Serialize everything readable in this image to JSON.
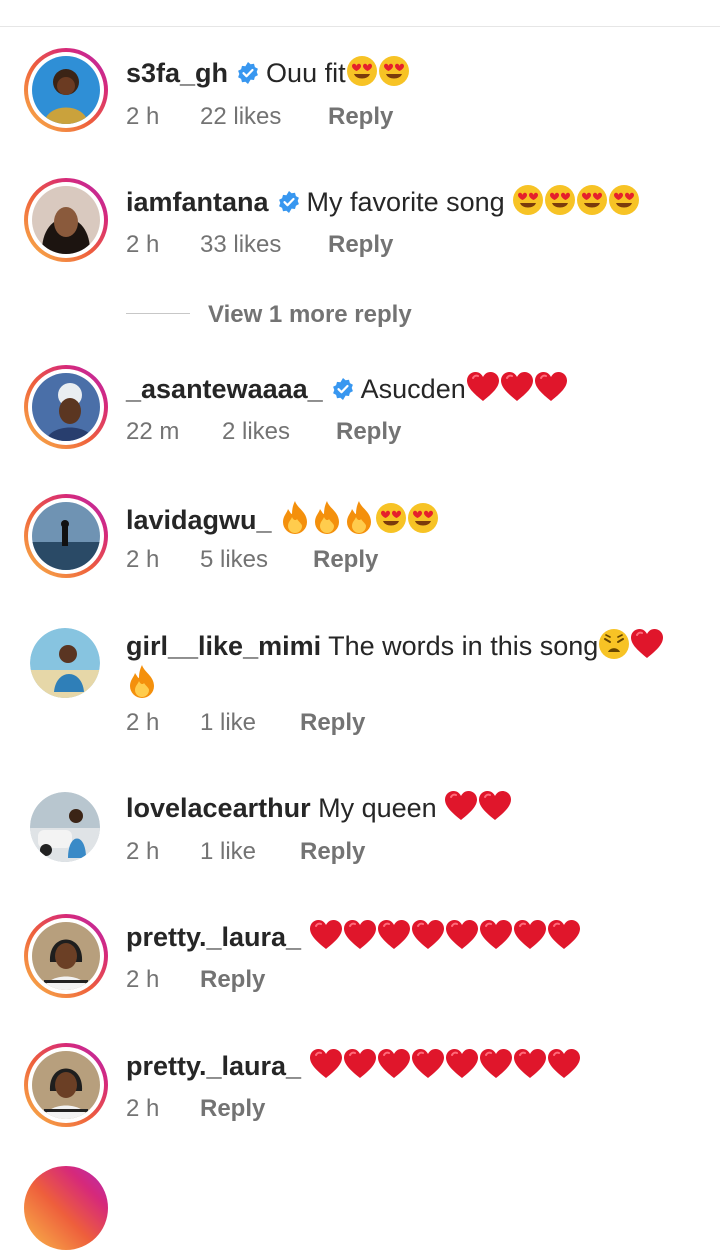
{
  "comments": [
    {
      "username": "s3fa_gh",
      "verified": true,
      "text": "Ouu fit",
      "emojis": [
        "heart-eyes",
        "heart-eyes"
      ],
      "time": "2 h",
      "likes": "22 likes",
      "reply": "Reply"
    },
    {
      "username": "iamfantana",
      "verified": true,
      "text": "My favorite song ",
      "emojis": [
        "heart-eyes",
        "heart-eyes",
        "heart-eyes",
        "heart-eyes"
      ],
      "time": "2 h",
      "likes": "33 likes",
      "reply": "Reply"
    },
    {
      "username": "_asantewaaaa_",
      "verified": true,
      "text": "Asucden",
      "emojis": [
        "red-heart",
        "red-heart",
        "red-heart"
      ],
      "time": "22 m",
      "likes": "2 likes",
      "reply": "Reply"
    },
    {
      "username": "lavidagwu_",
      "verified": false,
      "text": "",
      "emojis": [
        "fire",
        "fire",
        "fire",
        "heart-eyes",
        "heart-eyes"
      ],
      "time": "2 h",
      "likes": "5 likes",
      "reply": "Reply"
    },
    {
      "username": "girl__like_mimi",
      "verified": false,
      "text": "The words in this song",
      "emojis": [
        "weary-face",
        "red-heart"
      ],
      "emojis_line2": [
        "fire"
      ],
      "time": "2 h",
      "likes": "1 like",
      "reply": "Reply"
    },
    {
      "username": "lovelacearthur",
      "verified": false,
      "text": "My queen ",
      "emojis": [
        "red-heart",
        "red-heart"
      ],
      "time": "2 h",
      "likes": "1 like",
      "reply": "Reply"
    },
    {
      "username": "pretty._laura_",
      "verified": false,
      "text": "",
      "emojis": [
        "red-heart",
        "red-heart",
        "red-heart",
        "red-heart",
        "red-heart",
        "red-heart",
        "red-heart",
        "red-heart"
      ],
      "time": "2 h",
      "likes": "",
      "reply": "Reply"
    },
    {
      "username": "pretty._laura_",
      "verified": false,
      "text": "",
      "emojis": [
        "red-heart",
        "red-heart",
        "red-heart",
        "red-heart",
        "red-heart",
        "red-heart",
        "red-heart",
        "red-heart"
      ],
      "time": "2 h",
      "likes": "",
      "reply": "Reply"
    }
  ],
  "view_more_replies": "View 1 more reply",
  "colors": {
    "verified_blue": "#3897f0",
    "meta_gray": "#737373",
    "heart_red": "#e0162b"
  }
}
